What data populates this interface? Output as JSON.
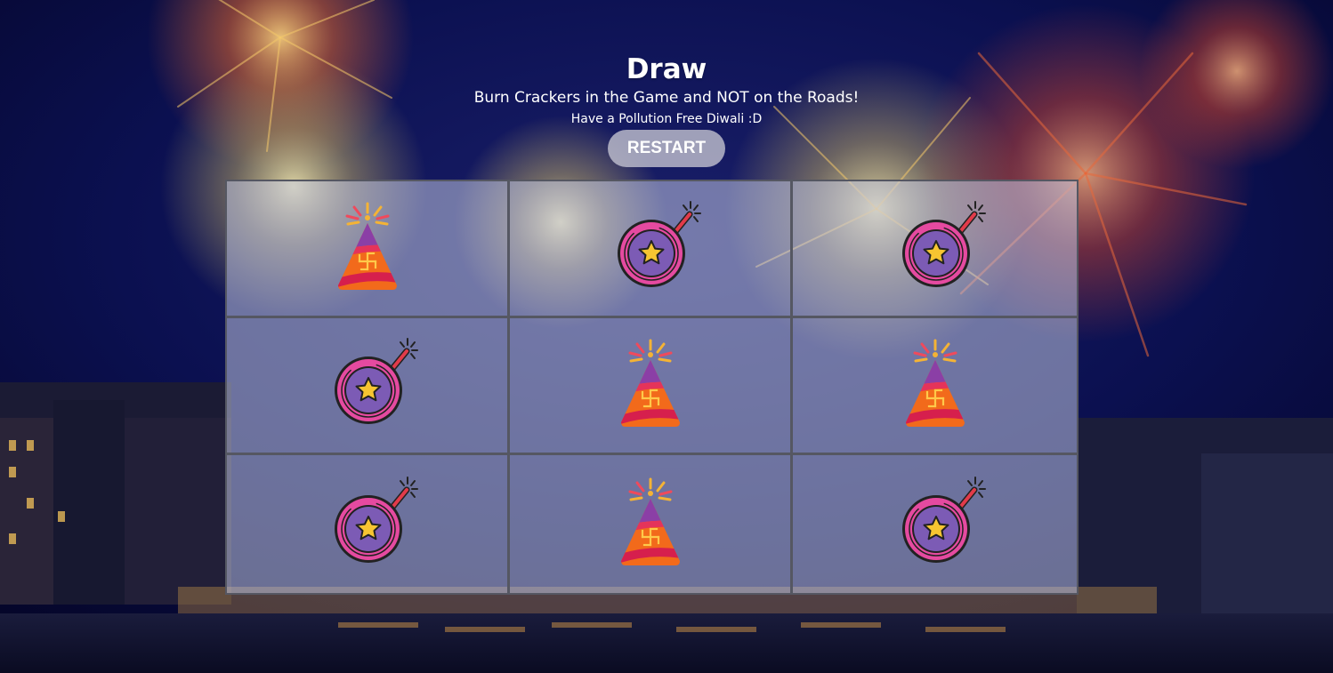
{
  "game": {
    "status": "Draw",
    "subtitle": "Burn Crackers in the Game and NOT on the Roads!",
    "tagline": "Have a Pollution Free Diwali :D",
    "restart_label": "RESTART"
  },
  "board": {
    "cells": [
      {
        "piece": "party-cone-cracker-icon"
      },
      {
        "piece": "bomb-cracker-icon"
      },
      {
        "piece": "bomb-cracker-icon"
      },
      {
        "piece": "bomb-cracker-icon"
      },
      {
        "piece": "party-cone-cracker-icon"
      },
      {
        "piece": "party-cone-cracker-icon"
      },
      {
        "piece": "bomb-cracker-icon"
      },
      {
        "piece": "party-cone-cracker-icon"
      },
      {
        "piece": "bomb-cracker-icon"
      }
    ]
  },
  "colors": {
    "background_sky": "#070a3a",
    "board_overlay": "#c8cde8",
    "grid_line": "#555762",
    "restart_button": "#bebecd",
    "text": "#ffffff"
  }
}
